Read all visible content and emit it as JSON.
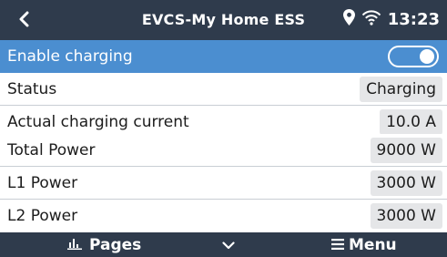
{
  "header": {
    "title": "EVCS-My Home ESS",
    "time": "13:23",
    "icons": [
      "back-arrow-icon",
      "location-pin-icon",
      "wifi-icon"
    ]
  },
  "rows": [
    {
      "label": "Enable charging",
      "control": "toggle",
      "enabled": true
    },
    {
      "label": "Status",
      "value": "Charging"
    },
    {
      "label": "Actual charging current",
      "value": "10.0 A"
    },
    {
      "label": "Total Power",
      "value": "9000 W"
    },
    {
      "label": "L1 Power",
      "value": "3000 W"
    },
    {
      "label": "L2 Power",
      "value": "3000 W"
    }
  ],
  "footer": {
    "pages_label": "Pages",
    "menu_label": "Menu",
    "icons": [
      "bar-chart-icon",
      "chevron-down-icon",
      "hamburger-menu-icon"
    ]
  },
  "colors": {
    "header_bg": "#2f3b4c",
    "highlight": "#4b8ed0",
    "value_bg": "#e5e6e8"
  }
}
